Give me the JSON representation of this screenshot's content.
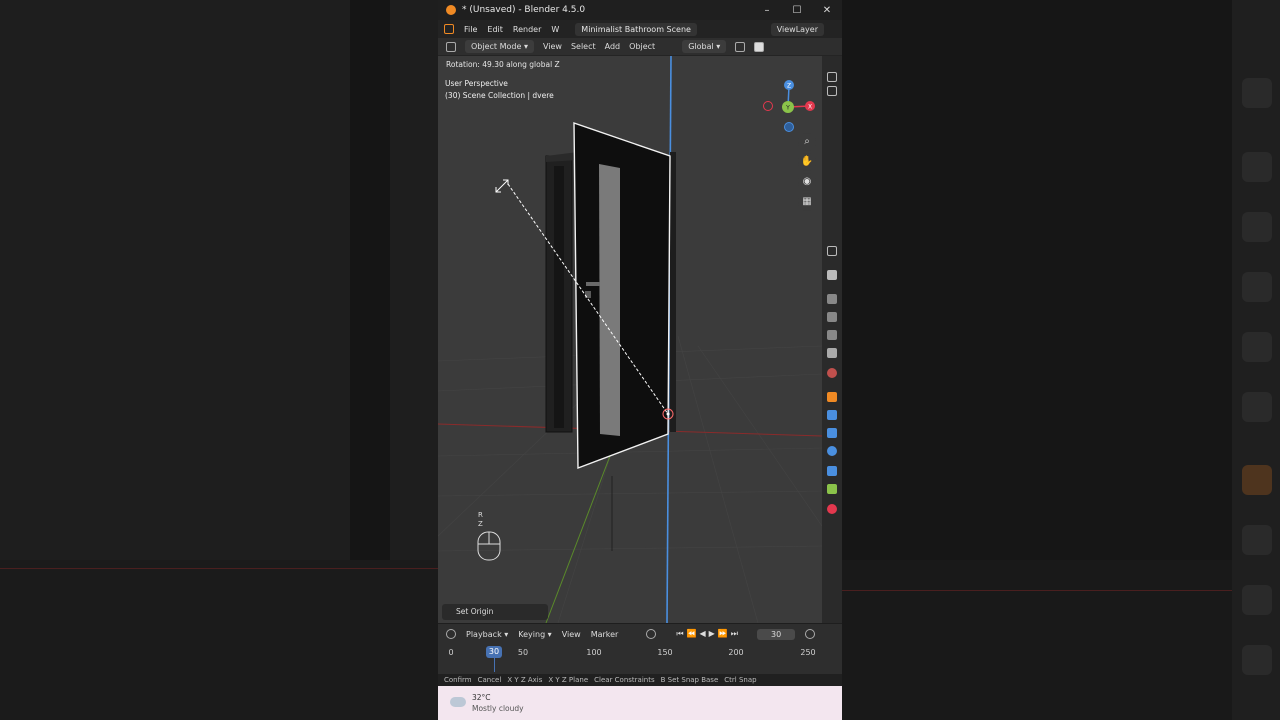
{
  "window": {
    "title": "* (Unsaved) - Blender 4.5.0"
  },
  "menubar": {
    "items": [
      "File",
      "Edit",
      "Render",
      "W"
    ],
    "scene": "Minimalist Bathroom Scene",
    "view_layer": "ViewLayer"
  },
  "header": {
    "mode": "Object Mode",
    "menus": [
      "View",
      "Select",
      "Add",
      "Object"
    ],
    "orientation": "Global"
  },
  "viewport": {
    "operator_status": "Rotation: 49.30 along global Z",
    "perspective": "User Perspective",
    "collection": "(30) Scene Collection | dvere",
    "set_origin": "Set Origin",
    "key_hint_r": "R",
    "key_hint_z": "Z",
    "gizmo_axes": {
      "z": "Z",
      "y": "Y",
      "x": "X"
    }
  },
  "timeline": {
    "menus": [
      "Playback",
      "Keying",
      "View",
      "Marker"
    ],
    "current_frame": "30",
    "ticks": [
      "0",
      "30",
      "50",
      "100",
      "150",
      "200",
      "250"
    ]
  },
  "statusbar": {
    "items": [
      "Confirm",
      "Cancel",
      "X Y Z Axis",
      "X Y Z Plane",
      "Clear Constraints",
      "B Set Snap Base",
      "Ctrl Snap"
    ]
  },
  "taskbar": {
    "temperature": "32°C",
    "weather": "Mostly cloudy"
  },
  "colors": {
    "accent": "#4772b3",
    "x_axis": "#e4384e",
    "y_axis": "#8bc34a",
    "z_axis": "#4a8fe0",
    "blender_orange": "#f08a24"
  }
}
